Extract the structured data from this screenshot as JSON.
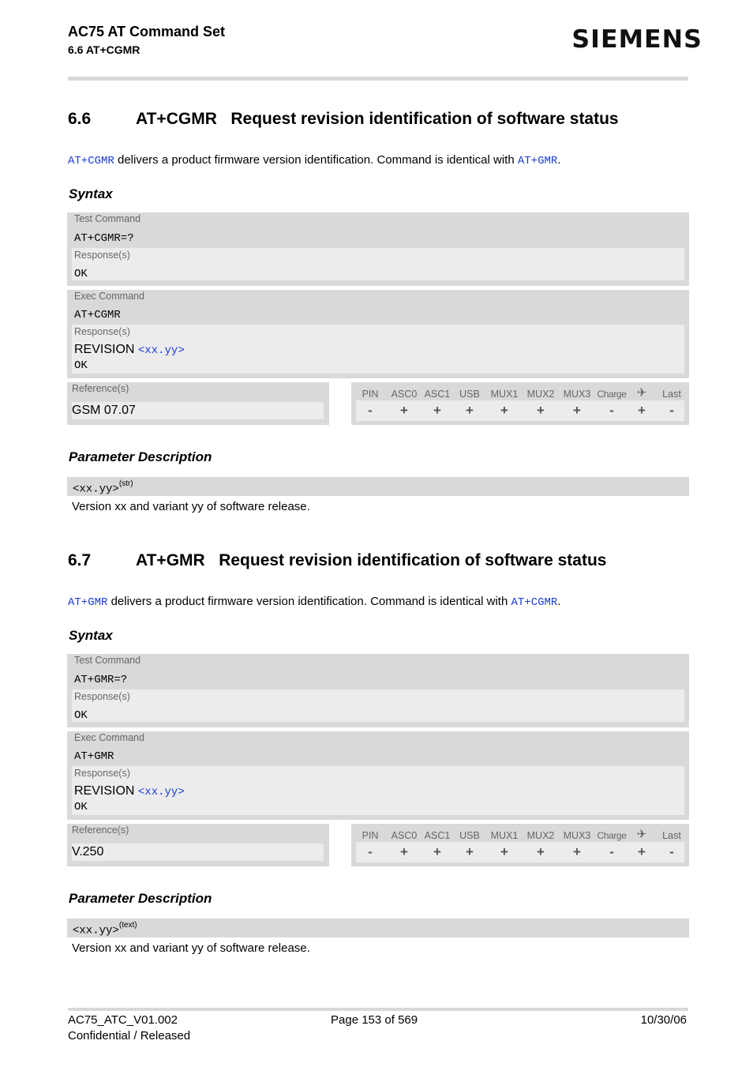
{
  "header": {
    "doc_title": "AC75 AT Command Set",
    "section_ref": "6.6 AT+CGMR",
    "logo": "SIEMENS"
  },
  "sections": [
    {
      "number": "6.6",
      "title": "AT+CGMR   Request revision identification of software status",
      "intro_link": "AT+CGMR",
      "intro_text": " delivers a product firmware version identification. Command is identical with ",
      "intro_link2": "AT+GMR",
      "intro_end": ".",
      "syntax_heading": "Syntax",
      "test_label": "Test Command",
      "test_cmd": "AT+CGMR=?",
      "test_resp_label": "Response(s)",
      "test_resp": "OK",
      "exec_label": "Exec Command",
      "exec_cmd": "AT+CGMR",
      "exec_resp_label": "Response(s)",
      "exec_resp_text": "REVISION ",
      "exec_resp_param": "<xx.yy>",
      "exec_resp_ok": "OK",
      "ref_label": "Reference(s)",
      "ref_value": "GSM 07.07",
      "param_heading": "Parameter Description",
      "param_name": "<xx.yy>",
      "param_type": "(str)",
      "param_desc": "Version xx and variant yy of software release."
    },
    {
      "number": "6.7",
      "title": "AT+GMR   Request revision identification of software status",
      "intro_link": "AT+GMR",
      "intro_text": " delivers a product firmware version identification. Command is identical with ",
      "intro_link2": "AT+CGMR",
      "intro_end": ".",
      "syntax_heading": "Syntax",
      "test_label": "Test Command",
      "test_cmd": "AT+GMR=?",
      "test_resp_label": "Response(s)",
      "test_resp": "OK",
      "exec_label": "Exec Command",
      "exec_cmd": "AT+GMR",
      "exec_resp_label": "Response(s)",
      "exec_resp_text": "REVISION ",
      "exec_resp_param": "<xx.yy>",
      "exec_resp_ok": "OK",
      "ref_label": "Reference(s)",
      "ref_value": "V.250",
      "param_heading": "Parameter Description",
      "param_name": "<xx.yy>",
      "param_type": "(text)",
      "param_desc": "Version xx and variant yy of software release."
    }
  ],
  "support_table": {
    "headers": [
      "PIN",
      "ASC0",
      "ASC1",
      "USB",
      "MUX1",
      "MUX2",
      "MUX3",
      "Charge",
      "airplane-icon",
      "Last"
    ],
    "rows": [
      [
        "-",
        "+",
        "+",
        "+",
        "+",
        "+",
        "+",
        "-",
        "+",
        "-"
      ],
      [
        "-",
        "+",
        "+",
        "+",
        "+",
        "+",
        "+",
        "-",
        "+",
        "-"
      ]
    ]
  },
  "footer": {
    "doc_id": "AC75_ATC_V01.002",
    "classification": "Confidential / Released",
    "page": "Page 153 of 569",
    "date": "10/30/06"
  }
}
